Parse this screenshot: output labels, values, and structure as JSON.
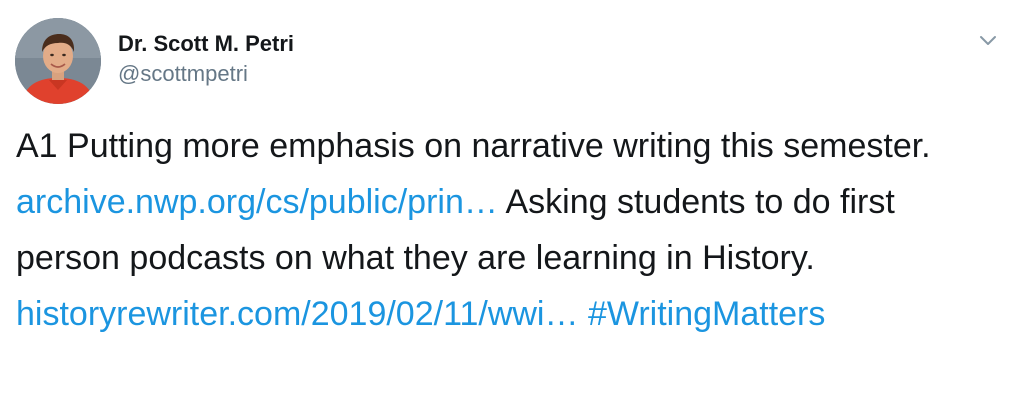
{
  "author": {
    "display_name": "Dr. Scott M. Petri",
    "handle": "@scottmpetri",
    "avatar_icon": "profile-photo"
  },
  "menu": {
    "icon": "chevron-down-icon"
  },
  "tweet": {
    "text_1": "A1 Putting more emphasis on narrative writing this semester.",
    "link_1": "archive.nwp.org/cs/public/prin…",
    "text_2": "Asking students to do first person podcasts on what they are learning in History.",
    "link_2": "historyrewriter.com/2019/02/11/wwi…",
    "hashtag": "#WritingMatters"
  },
  "colors": {
    "link": "#1b95e0",
    "text": "#14171a",
    "secondary": "#657786"
  }
}
